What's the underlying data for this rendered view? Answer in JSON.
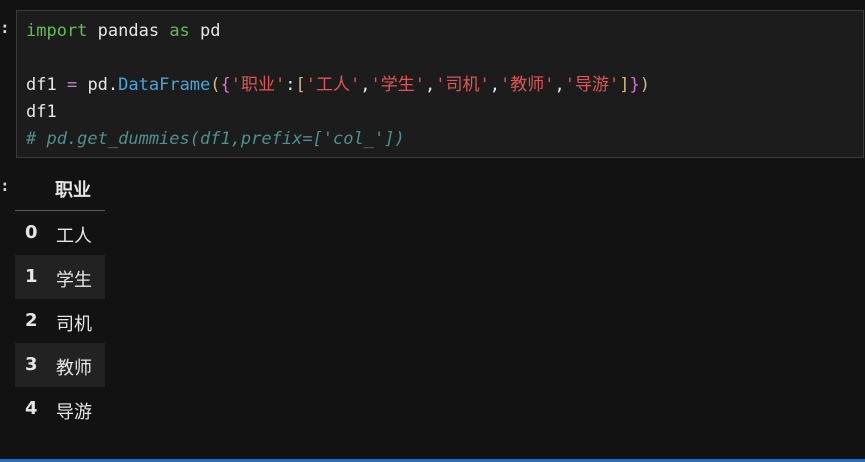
{
  "input_cell": {
    "prompt_marker": ":",
    "lines": [
      {
        "tokens": [
          {
            "t": "import",
            "c": "kw"
          },
          {
            "t": " pandas ",
            "c": "plain"
          },
          {
            "t": "as",
            "c": "kw"
          },
          {
            "t": " pd",
            "c": "plain"
          }
        ]
      },
      {
        "tokens": []
      },
      {
        "tokens": [
          {
            "t": "df1",
            "c": "plain"
          },
          {
            "t": " = ",
            "c": "op"
          },
          {
            "t": "pd.",
            "c": "plain"
          },
          {
            "t": "DataFrame",
            "c": "fn"
          },
          {
            "t": "(",
            "c": "brk"
          },
          {
            "t": "{",
            "c": "brk2"
          },
          {
            "t": "'职业'",
            "c": "str"
          },
          {
            "t": ":",
            "c": "plain"
          },
          {
            "t": "[",
            "c": "brk"
          },
          {
            "t": "'工人'",
            "c": "str"
          },
          {
            "t": ",",
            "c": "plain"
          },
          {
            "t": "'学生'",
            "c": "str"
          },
          {
            "t": ",",
            "c": "plain"
          },
          {
            "t": "'司机'",
            "c": "str"
          },
          {
            "t": ",",
            "c": "plain"
          },
          {
            "t": "'教师'",
            "c": "str"
          },
          {
            "t": ",",
            "c": "plain"
          },
          {
            "t": "'导游'",
            "c": "str"
          },
          {
            "t": "]",
            "c": "brk"
          },
          {
            "t": "}",
            "c": "brk2"
          },
          {
            "t": ")",
            "c": "brk"
          }
        ]
      },
      {
        "tokens": [
          {
            "t": "df1",
            "c": "plain"
          }
        ]
      },
      {
        "tokens": [
          {
            "t": "# pd.get_dummies(df1,prefix=['col_'])",
            "c": "com"
          }
        ]
      }
    ]
  },
  "output_cell": {
    "prompt_marker": ":",
    "table": {
      "columns": [
        "职业"
      ],
      "rows": [
        {
          "index": "0",
          "value": "工人"
        },
        {
          "index": "1",
          "value": "学生"
        },
        {
          "index": "2",
          "value": "司机"
        },
        {
          "index": "3",
          "value": "教师"
        },
        {
          "index": "4",
          "value": "导游"
        }
      ]
    }
  },
  "colors": {
    "background": "#121212",
    "code_background": "#1c1c1c",
    "keyword": "#5fbf4f",
    "function": "#4aa3d9",
    "string": "#e05555",
    "comment": "#4e8f8f",
    "accent_bar": "#1f6fc5"
  }
}
